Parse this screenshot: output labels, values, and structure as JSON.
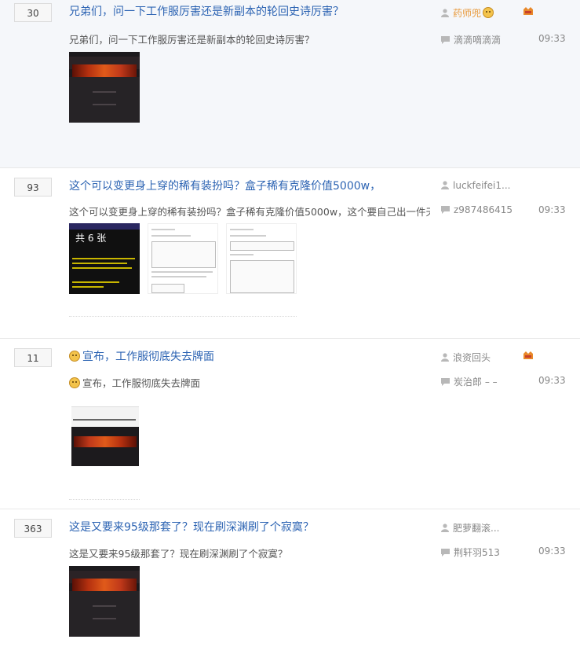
{
  "threads": [
    {
      "reply_count": "30",
      "title": "兄弟们，问一下工作服厉害还是新副本的轮回史诗厉害？",
      "excerpt": "兄弟们，问一下工作服厉害还是新副本的轮回史诗厉害？",
      "author": "药师兜",
      "last_reply": "滴滴嘀滴滴",
      "time": "09:33"
    },
    {
      "reply_count": "93",
      "title": "这个可以变更身上穿的稀有装扮吗？盒子稀有克隆价值5000w，",
      "excerpt": "这个可以变更身上穿的稀有装扮吗？盒子稀有克隆价值5000w，这个要自己出一件天...",
      "author": "luckfeifei1...",
      "last_reply": "z987486415",
      "time": "09:33",
      "image_caption": "共 6 张"
    },
    {
      "reply_count": "11",
      "title": "宣布，工作服彻底失去牌面",
      "excerpt": "宣布，工作服彻底失去牌面",
      "author": "浪资回头",
      "last_reply": "炭治郎 – –",
      "time": "09:33"
    },
    {
      "reply_count": "363",
      "title": "这是又要来95级那套了？现在刷深渊刷了个寂寞？",
      "excerpt": "这是又要来95级那套了？现在刷深渊刷了个寂寞？",
      "author": "肥萝翻滚...",
      "last_reply": "荆轩羽513",
      "time": "09:33"
    }
  ],
  "colors": {
    "title": "#2d64b3",
    "author_highlight": "#e89a3c",
    "meta": "#888888"
  },
  "icons": {
    "author": "user-icon",
    "reply": "reply-bubble-icon",
    "badge": "hot-thread-icon"
  }
}
